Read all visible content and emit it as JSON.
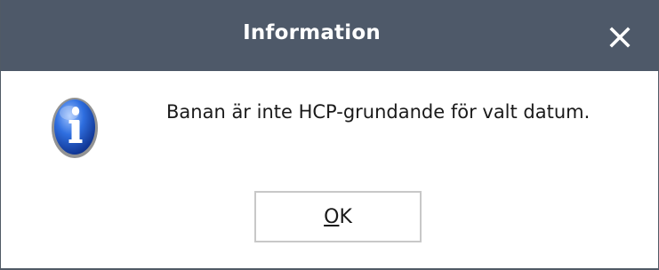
{
  "dialog": {
    "title": "Information",
    "message": "Banan är inte HCP-grundande för valt datum.",
    "icon": "info-icon",
    "close_icon": "close-icon",
    "ok_button": {
      "mnemonic": "O",
      "rest": "K"
    }
  },
  "colors": {
    "titlebar": "#4e5969",
    "title_text": "#ffffff",
    "background": "#ffffff",
    "button_border": "#c8c8c8"
  }
}
